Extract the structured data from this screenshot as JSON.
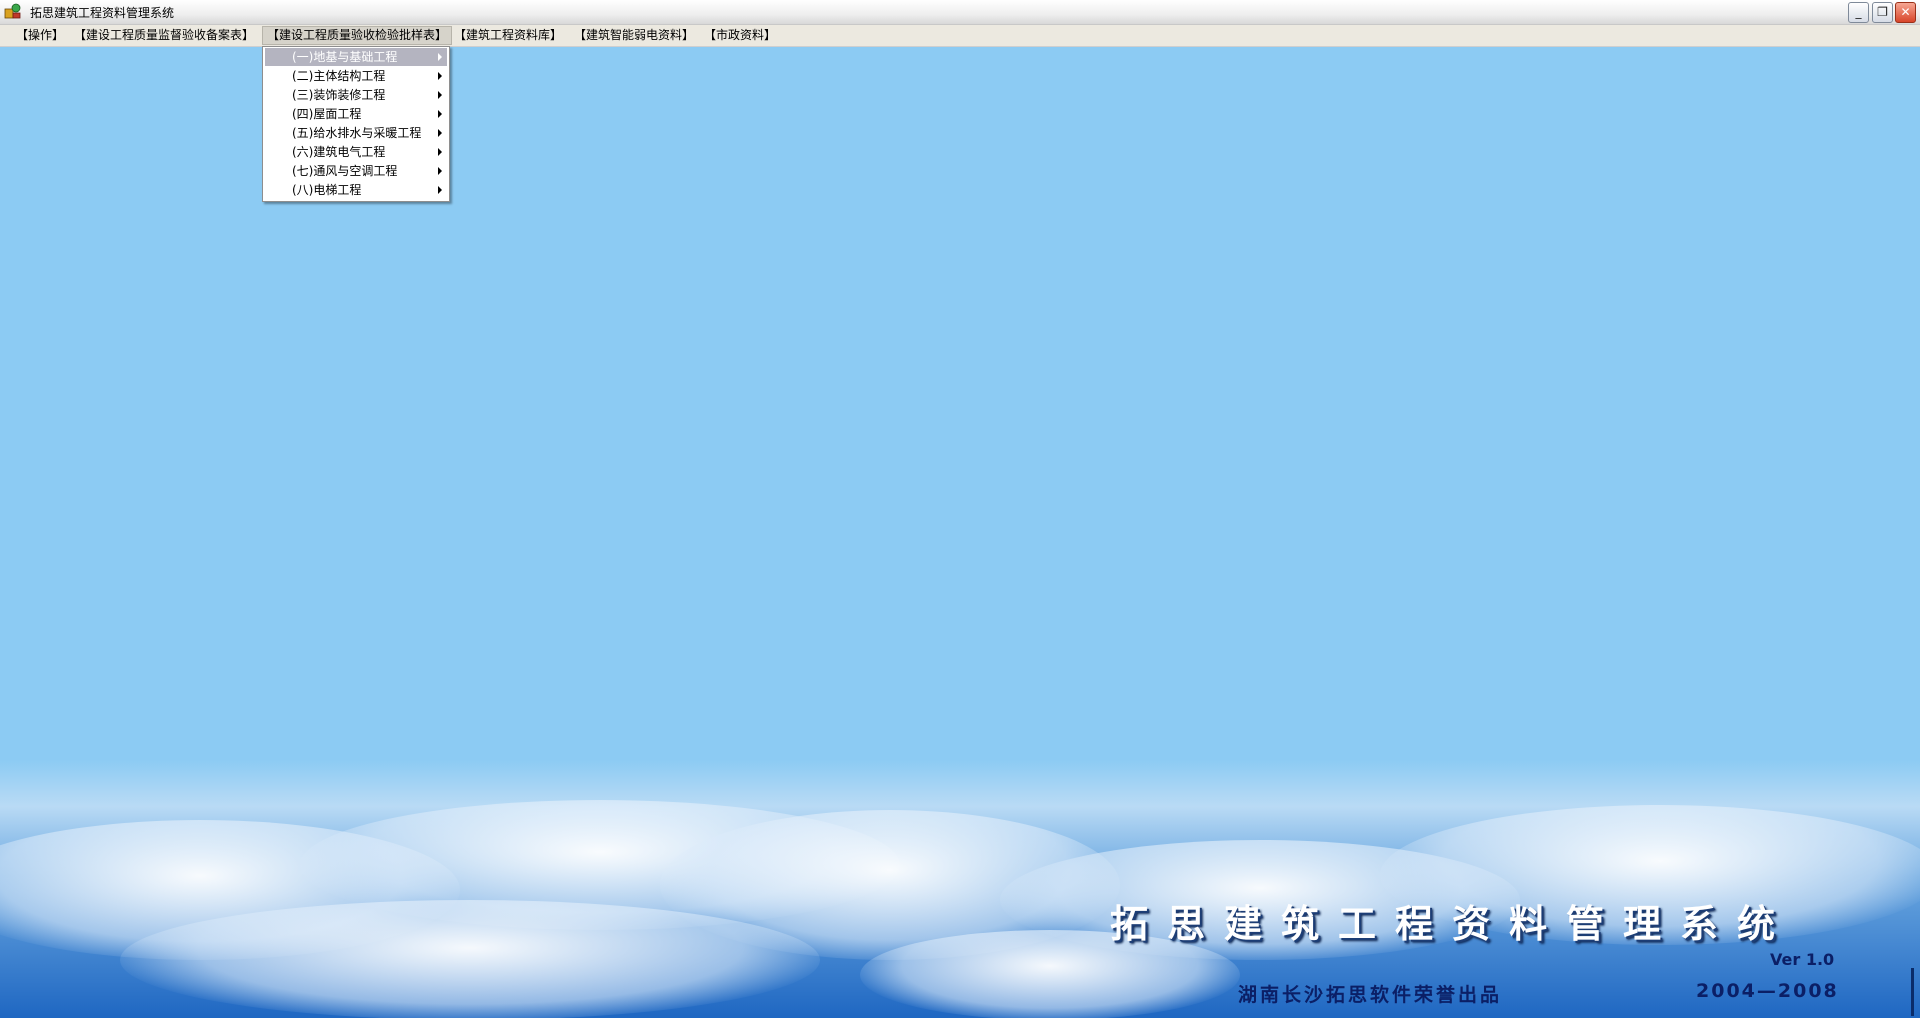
{
  "window": {
    "title": "拓思建筑工程资料管理系统",
    "icon": "app-logo-icon",
    "controls": {
      "minimize": "_",
      "restore": "❐",
      "close": "✕"
    }
  },
  "menubar": {
    "items": [
      {
        "label": "【操作】"
      },
      {
        "label": "【建设工程质量监督验收备案表】"
      },
      {
        "label": "【建设工程质量验收检验批样表】"
      },
      {
        "label": "【建筑工程资料库】"
      },
      {
        "label": "【建筑智能弱电资料】"
      },
      {
        "label": "【市政资料】"
      }
    ],
    "open_index": 2
  },
  "dropdown": {
    "selected_index": 0,
    "items": [
      {
        "label": "(一)地基与基础工程",
        "has_submenu": true
      },
      {
        "label": "(二)主体结构工程",
        "has_submenu": true
      },
      {
        "label": "(三)装饰装修工程",
        "has_submenu": true
      },
      {
        "label": "(四)屋面工程",
        "has_submenu": true
      },
      {
        "label": "(五)给水排水与采暖工程",
        "has_submenu": true
      },
      {
        "label": "(六)建筑电气工程",
        "has_submenu": true
      },
      {
        "label": "(七)通风与空调工程",
        "has_submenu": true
      },
      {
        "label": "(八)电梯工程",
        "has_submenu": true
      }
    ]
  },
  "background": {
    "brand_title": "拓思建筑工程资料管理系统",
    "version": "Ver 1.0",
    "credit": "湖南长沙拓思软件荣誉出品",
    "years": "2004—2008"
  },
  "colors": {
    "sky": "#8ccbf3",
    "menubar": "#ece9e0",
    "selected_item": "#b4b4c0",
    "brand_dark": "#0b1f66"
  }
}
